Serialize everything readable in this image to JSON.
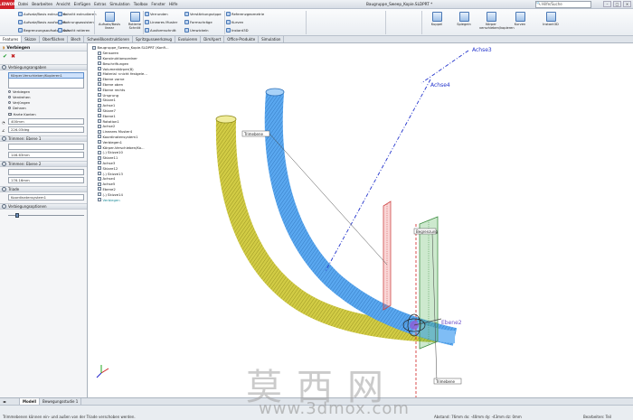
{
  "app": {
    "logo_text": "SOLIDWORKS",
    "window_title": "Baugruppe_Sweep_Kopie.SLDPRT *",
    "search_placeholder": "Hilfe/Suche"
  },
  "menu": [
    "Datei",
    "Bearbeiten",
    "Ansicht",
    "Einfügen",
    "Extras",
    "Simulation",
    "Toolbox",
    "Fenster",
    "Hilfe"
  ],
  "ribbon": {
    "buttons_small": [
      "Aufsatz/Basis extrudieren",
      "Aufsatz/Basis ausformen",
      "Begrenzungsaufsatz/-basis",
      "Schnitt extrudieren",
      "Bohrungsassistent",
      "Schnitt rotieren",
      "Verrunden",
      "Lineares Muster",
      "Ausformschnitt",
      "Verstärkungsrippe",
      "Formschräge",
      "Umwickeln",
      "Referenzgeometrie",
      "Kurven",
      "Instant3D"
    ],
    "buttons_big": [
      "Aufsatz/Basis linear",
      "Rotierte Schnitt",
      "Kuppel",
      "Spiegeln",
      "Körper verschieben/kopieren",
      "Kurven",
      "Instant3D"
    ]
  },
  "cmd_tabs": [
    "Features",
    "Skizze",
    "Oberflächen",
    "Blech",
    "Schweißkonstruktionen",
    "Spritzgusswerkzeug",
    "Evaluieren",
    "DimXpert",
    "Office-Produkte",
    "Simulation"
  ],
  "property_manager": {
    "title": "Verbiegen",
    "sections": {
      "params": "Verbiegungsangaben",
      "trim1": "Trimmen: Ebene 1",
      "trim2": "Trimmen: Ebene 2",
      "triad": "Triade",
      "options": "Verbiegungsoptionen"
    },
    "bodies_field": "Körper-Verschieben/Kopieren1",
    "radio_options": [
      "Verbiegen",
      "Verdrehen",
      "Verjüngen",
      "Dehnen"
    ],
    "hard_edges_label": "Harte Kanten",
    "value1": "400mm",
    "value2": "226.03deg",
    "plane1_value": "146.63mm",
    "plane2_value": "176.16mm",
    "triad_value": "Koordinatensystem1",
    "slider_value_pct": 10
  },
  "feature_tree": {
    "root": "Baugruppe_Sweep_Kopie.SLDPRT (Konfi...",
    "items": [
      "Sensoren",
      "Konstruktionsordner",
      "Beschriftungen",
      "Volumenkörper(8)",
      "Material <nicht festgele...",
      "Ebene vorne",
      "Ebene oben",
      "Ebene rechts",
      "Ursprung",
      "Skizze1",
      "Achse1",
      "Skizze7",
      "Ebene1",
      "Rotation1",
      "Achse2",
      "Lineares Muster4",
      "Koordinatensystem1",
      "Verbiegen1",
      "Körper-Verschieben/Ko...",
      "(-) Skizze10",
      "Skizze11",
      "Achse3",
      "Skizze12",
      "(-) Skizze13",
      "Achse4",
      "Achse5",
      "Ebene2",
      "(-) Skizze14",
      "Verbiegen"
    ]
  },
  "viewport": {
    "labels": {
      "achse3": "Achse3",
      "achse4": "Achse4",
      "trimebene1": "Trimebene",
      "trimebene2": "Trimebene",
      "ebene_label": "Ebene2",
      "plane_tag": "Begrenzung"
    },
    "colors": {
      "tube_yellow": "#c8c23a",
      "tube_blue": "#4a9be6",
      "plane_red": "#e05050",
      "plane_green": "#4caf50",
      "axis_blue": "#2233cc"
    }
  },
  "bottom_tabs": [
    "Modell",
    "Bewegungsstudie 1"
  ],
  "status": {
    "left": "Trimmebenen können ein- und außen von der Triade verschoben werden.",
    "right": "Abstand: 76mm   dx: -40mm   dy: -43mm   dz: 0mm",
    "right2": "Bearbeiten: Teil"
  },
  "watermark": {
    "chinese": "莫西网",
    "url": "www.3dmox.com"
  }
}
